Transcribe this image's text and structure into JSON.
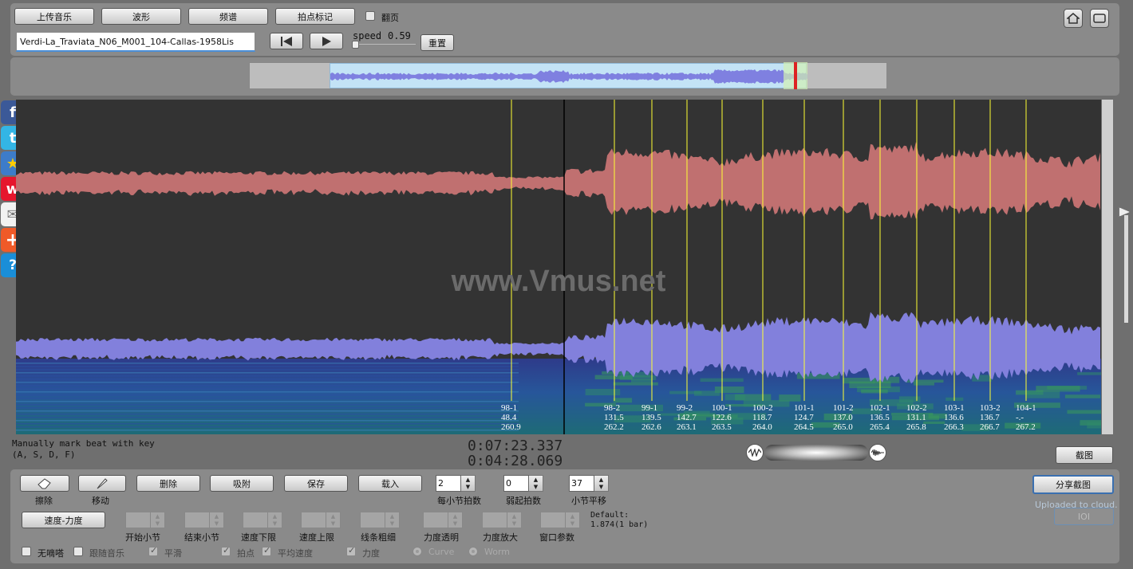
{
  "toolbar": {
    "upload_label": "上传音乐",
    "waveform_label": "波形",
    "spectrum_label": "频谱",
    "beatmark_label": "拍点标记",
    "pageflip_label": "翻页",
    "filename": "Verdi-La_Traviata_N06_M001_104-Callas-1958Lis",
    "speed_label": "speed",
    "speed_value": "0.59",
    "reset_label": "重置"
  },
  "canvas": {
    "watermark": "www.Vmus.net",
    "markers": [
      {
        "label": "98-1",
        "tempo": "48.4",
        "time": "260.9"
      },
      {
        "label": "98-2",
        "tempo": "131.5",
        "time": "262.2"
      },
      {
        "label": "99-1",
        "tempo": "139.5",
        "time": "262.6"
      },
      {
        "label": "99-2",
        "tempo": "142.7",
        "time": "263.1"
      },
      {
        "label": "100-1",
        "tempo": "122.6",
        "time": "263.5"
      },
      {
        "label": "100-2",
        "tempo": "118.7",
        "time": "264.0"
      },
      {
        "label": "101-1",
        "tempo": "124.7",
        "time": "264.5"
      },
      {
        "label": "101-2",
        "tempo": "137.0",
        "time": "265.0"
      },
      {
        "label": "102-1",
        "tempo": "136.5",
        "time": "265.4"
      },
      {
        "label": "102-2",
        "tempo": "131.1",
        "time": "265.8"
      },
      {
        "label": "103-1",
        "tempo": "136.6",
        "time": "266.3"
      },
      {
        "label": "103-2",
        "tempo": "136.7",
        "time": "266.7"
      },
      {
        "label": "104-1",
        "tempo": "-.-",
        "time": "267.2"
      }
    ]
  },
  "status": {
    "hint_line1": "Manually mark beat with key",
    "hint_line2": "(A, S, D, F)",
    "time_total": "0:07:23.337",
    "time_current": "0:04:28.069",
    "screenshot_label": "截图"
  },
  "bottom": {
    "erase_label": "擦除",
    "move_label": "移动",
    "delete_label": "删除",
    "snap_label": "吸附",
    "save_label": "保存",
    "load_label": "载入",
    "beats_per_bar_value": "2",
    "beats_per_bar_label": "每小节拍数",
    "pickup_value": "0",
    "pickup_label": "弱起拍数",
    "bar_shift_value": "37",
    "bar_shift_label": "小节平移",
    "share_label": "分享截图",
    "uploaded_text": "Uploaded to cloud.",
    "ioi_label": "IOI",
    "tempo_dyn_label": "速度-力度",
    "start_bar_label": "开始小节",
    "end_bar_label": "结束小节",
    "tempo_min_label": "速度下限",
    "tempo_max_label": "速度上限",
    "line_width_label": "线条粗细",
    "dyn_alpha_label": "力度透明",
    "dyn_zoom_label": "力度放大",
    "window_label": "窗口参数",
    "default_line1": "Default:",
    "default_line2": "1.874(1 bar)",
    "nodrip_label": "无嘀嗒",
    "follow_label": "跟随音乐",
    "smooth_label": "平滑",
    "beatpoint_label": "拍点",
    "avgspeed_label": "平均速度",
    "dynamics_label": "力度",
    "curve_label": "Curve",
    "worm_label": "Worm"
  },
  "social": [
    "facebook-icon",
    "twitter-icon",
    "favorite-icon",
    "weibo-icon",
    "mail-icon",
    "plus-icon",
    "help-icon"
  ],
  "colors": {
    "canvas_bg": "#333333",
    "wave_top": "#c87676",
    "wave_bottom": "#8482e0",
    "marker": "#ffff33"
  }
}
